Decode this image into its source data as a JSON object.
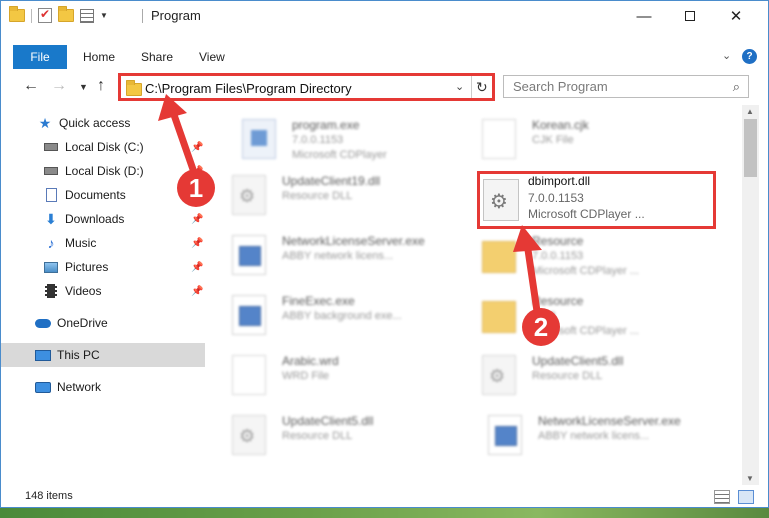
{
  "window": {
    "title": "Program"
  },
  "ribbon": {
    "tabs": [
      {
        "label": "File"
      },
      {
        "label": "Home"
      },
      {
        "label": "Share"
      },
      {
        "label": "View"
      }
    ]
  },
  "address": {
    "path": "C:\\Program Files\\Program Directory"
  },
  "search": {
    "placeholder": "Search Program"
  },
  "sidebar": {
    "items": [
      {
        "label": "Quick access",
        "icon": "star-icon"
      },
      {
        "label": "Local Disk (C:)",
        "icon": "drive-icon"
      },
      {
        "label": "Local Disk (D:)",
        "icon": "drive-icon"
      },
      {
        "label": "Documents",
        "icon": "documents-icon"
      },
      {
        "label": "Downloads",
        "icon": "download-icon"
      },
      {
        "label": "Music",
        "icon": "music-icon"
      },
      {
        "label": "Pictures",
        "icon": "pictures-icon"
      },
      {
        "label": "Videos",
        "icon": "videos-icon"
      },
      {
        "label": "OneDrive",
        "icon": "cloud-icon"
      },
      {
        "label": "This PC",
        "icon": "computer-icon"
      },
      {
        "label": "Network",
        "icon": "network-icon"
      }
    ]
  },
  "files": [
    {
      "name": "program.exe",
      "line1": "7.0.0.1153",
      "line2": "Microsoft CDPlayer",
      "icon": "program-icon"
    },
    {
      "name": "Korean.cjk",
      "line1": "CJK File",
      "line2": "",
      "icon": "document-icon"
    },
    {
      "name": "UpdateClient19.dll",
      "line1": "Resource DLL",
      "line2": "",
      "icon": "dll-icon"
    },
    {
      "name": "NetworkLicenseServer.exe",
      "line1": "ABBY network licens...",
      "line2": "",
      "icon": "exe-icon"
    },
    {
      "name": "Resource",
      "line1": "7.0.0.1153",
      "line2": "Microsoft CDPlayer ...",
      "icon": "folder-icon"
    },
    {
      "name": "FineExec.exe",
      "line1": "ABBY background exe...",
      "line2": "",
      "icon": "exe-icon"
    },
    {
      "name": "Resource",
      "line1": "1153",
      "line2": "Microsoft CDPlayer ...",
      "icon": "folder-icon"
    },
    {
      "name": "Arabic.wrd",
      "line1": "WRD File",
      "line2": "",
      "icon": "document-icon"
    },
    {
      "name": "UpdateClient5.dll",
      "line1": "Resource DLL",
      "line2": "",
      "icon": "dll-icon"
    },
    {
      "name": "UpdateClient5.dll",
      "line1": "Resource DLL",
      "line2": "",
      "icon": "dll-icon"
    },
    {
      "name": "NetworkLicenseServer.exe",
      "line1": "ABBY network licens...",
      "line2": "",
      "icon": "exe-icon"
    }
  ],
  "highlighted_file": {
    "name": "dbimport.dll",
    "version": "7.0.0.1153",
    "description": "Microsoft CDPlayer ..."
  },
  "annotations": [
    {
      "label": "1"
    },
    {
      "label": "2"
    }
  ],
  "status": {
    "item_count": "148 items"
  },
  "colors": {
    "accent": "#1979ca",
    "annotation": "#e53935"
  }
}
